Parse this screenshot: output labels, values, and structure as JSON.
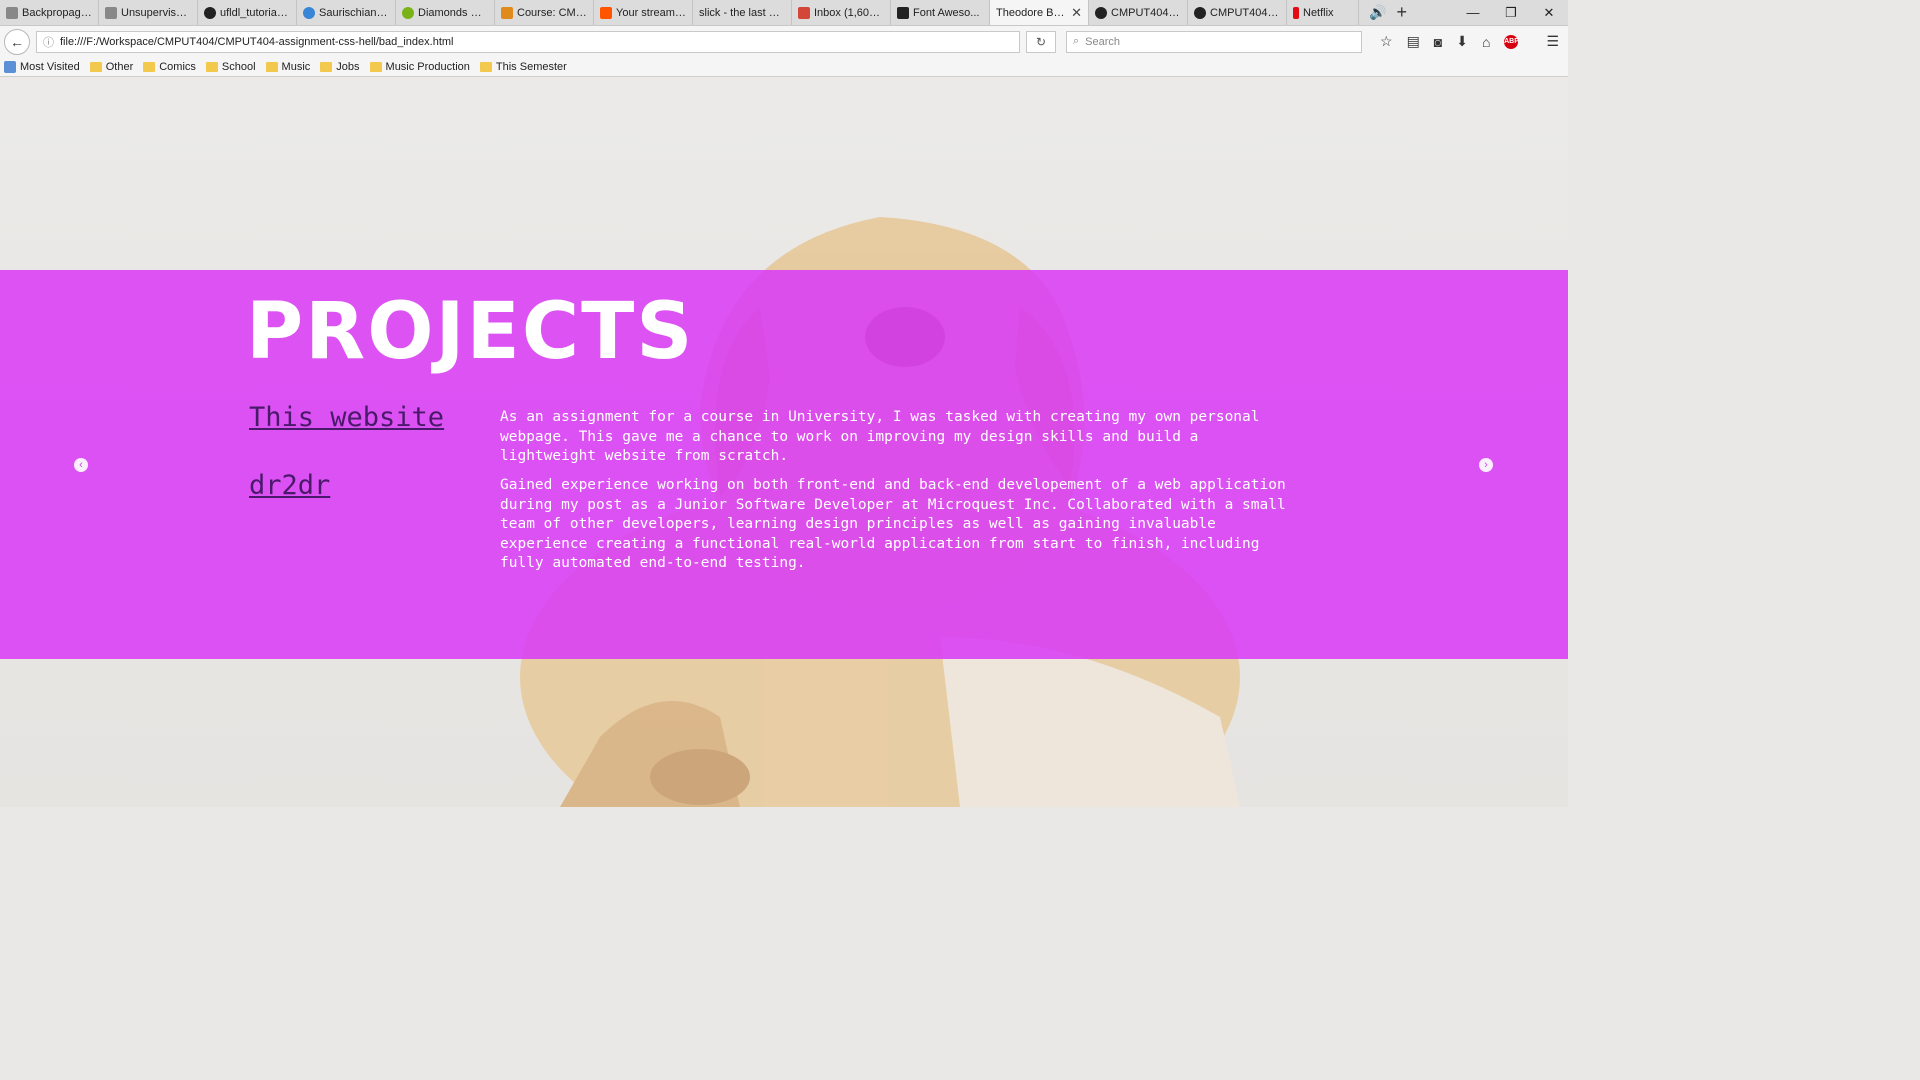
{
  "browser": {
    "tabs": [
      {
        "label": "Backpropagation ...",
        "icon": "generic-icon",
        "color": "#888888"
      },
      {
        "label": "Unsupervised Fea...",
        "icon": "generic-icon",
        "color": "#888888"
      },
      {
        "label": "ufldl_tutorial/...",
        "icon": "github-icon",
        "color": "#222222"
      },
      {
        "label": "Saurischians ...",
        "icon": "infinity-icon",
        "color": "#3a86d6"
      },
      {
        "label": "Diamonds Da...",
        "icon": "spotify-icon",
        "color": "#7ab317"
      },
      {
        "label": "Course: CMP...",
        "icon": "moodle-icon",
        "color": "#e08a1e"
      },
      {
        "label": "Your stream ...",
        "icon": "soundcloud-icon",
        "color": "#ff5500"
      },
      {
        "label": "slick - the last car...",
        "icon": "generic-icon",
        "color": "#dcdcdc"
      },
      {
        "label": "Inbox (1,609) ...",
        "icon": "gmail-icon",
        "color": "#d44638"
      },
      {
        "label": "Font Aweso...",
        "icon": "flag-icon",
        "color": "#222222"
      },
      {
        "label": "Theodore Bro...",
        "icon": "generic-icon",
        "color": "#f5f5f5",
        "active": true
      },
      {
        "label": "CMPUT404-a...",
        "icon": "github-icon",
        "color": "#222222"
      },
      {
        "label": "CMPUT404-a...",
        "icon": "github-icon",
        "color": "#222222"
      },
      {
        "label": "Netflix",
        "icon": "netflix-icon",
        "color": "#e50914"
      }
    ],
    "url": "file:///F:/Workspace/CMPUT404/CMPUT404-assignment-css-hell/bad_index.html",
    "search_placeholder": "Search",
    "bookmarks": [
      "Most Visited",
      "Other",
      "Comics",
      "School",
      "Music",
      "Jobs",
      "Music Production",
      "This Semester"
    ]
  },
  "page": {
    "heading": "PROJECTS",
    "projects": [
      {
        "title": "This website",
        "description": "As an assignment for a course in University, I was tasked with creating my own personal webpage. This gave me a chance to work on improving my design skills and build a lightweight website from scratch."
      },
      {
        "title": "dr2dr",
        "description": "Gained experience working on both front-end and back-end developement of a web application during my post as a Junior Software Developer at Microquest Inc. Collaborated with a small team of other developers, learning design principles as well as gaining invaluable experience creating a functional real-world application from start to finish, including fully automated end-to-end testing."
      }
    ],
    "colors": {
      "banner": "#da3cf5",
      "link": "#4a1a6a"
    }
  }
}
